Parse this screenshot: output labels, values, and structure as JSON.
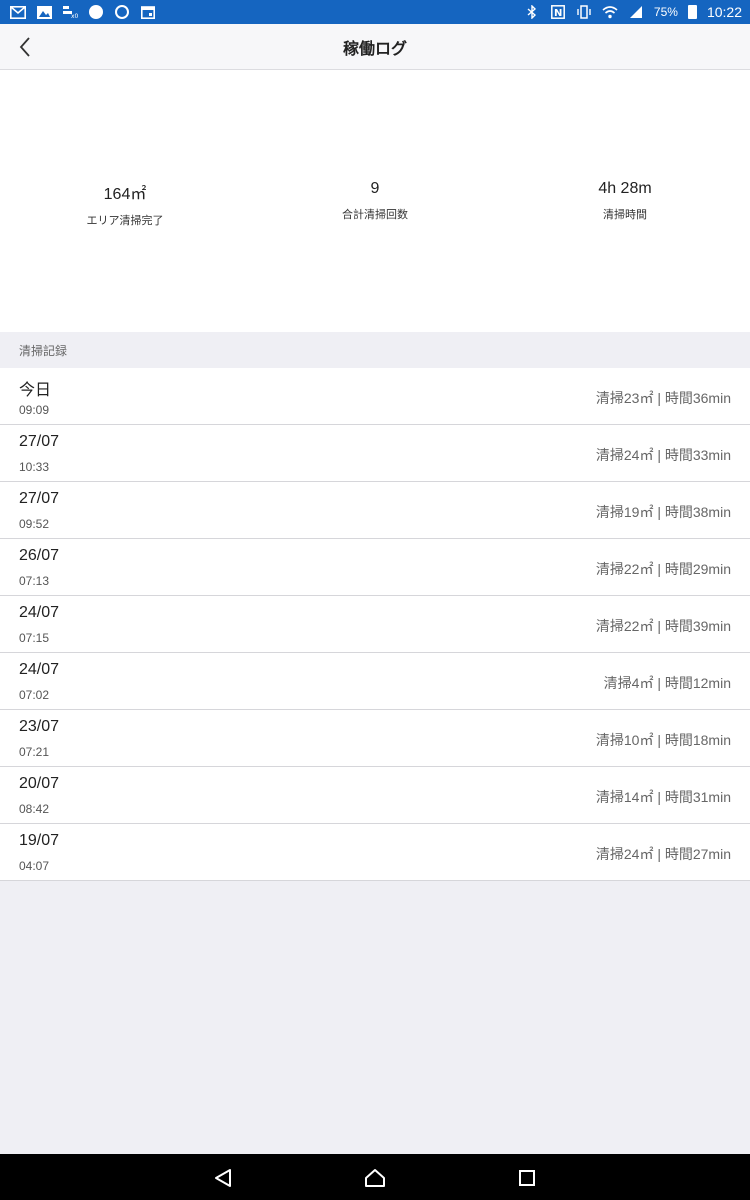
{
  "status_bar": {
    "battery": "75%",
    "time": "10:22",
    "left_icons": [
      "gmail-icon",
      "image-icon",
      "signal-alt-icon",
      "browser-icon",
      "record-icon",
      "calendar-icon"
    ],
    "right_icons": [
      "bluetooth-icon",
      "nfc-icon",
      "vibrate-icon",
      "wifi-icon",
      "cell-signal-icon",
      "battery-icon"
    ]
  },
  "header": {
    "title": "稼働ログ",
    "back_icon": "chevron-left-icon"
  },
  "summary": {
    "area": {
      "value": "164㎡",
      "label": "エリア清掃完了"
    },
    "count": {
      "value": "9",
      "label": "合計清掃回数"
    },
    "duration": {
      "value": "4h 28m",
      "label": "清掃時間"
    }
  },
  "records_section": {
    "title": "清掃記録",
    "items": [
      {
        "date": "今日",
        "time": "09:09",
        "summary": "清掃23㎡ | 時間36min"
      },
      {
        "date": "27/07",
        "time": "10:33",
        "summary": "清掃24㎡ | 時間33min"
      },
      {
        "date": "27/07",
        "time": "09:52",
        "summary": "清掃19㎡ | 時間38min"
      },
      {
        "date": "26/07",
        "time": "07:13",
        "summary": "清掃22㎡ | 時間29min"
      },
      {
        "date": "24/07",
        "time": "07:15",
        "summary": "清掃22㎡ | 時間39min"
      },
      {
        "date": "24/07",
        "time": "07:02",
        "summary": "清掃4㎡ | 時間12min"
      },
      {
        "date": "23/07",
        "time": "07:21",
        "summary": "清掃10㎡ | 時間18min"
      },
      {
        "date": "20/07",
        "time": "08:42",
        "summary": "清掃14㎡ | 時間31min"
      },
      {
        "date": "19/07",
        "time": "04:07",
        "summary": "清掃24㎡ | 時間27min"
      }
    ]
  },
  "nav_bar": {
    "icons": [
      "back-triangle-icon",
      "home-icon",
      "recents-icon"
    ]
  },
  "colors": {
    "status_bar": "#1565c0",
    "background": "#efeff4",
    "card": "#ffffff",
    "nav_bar": "#000000"
  }
}
